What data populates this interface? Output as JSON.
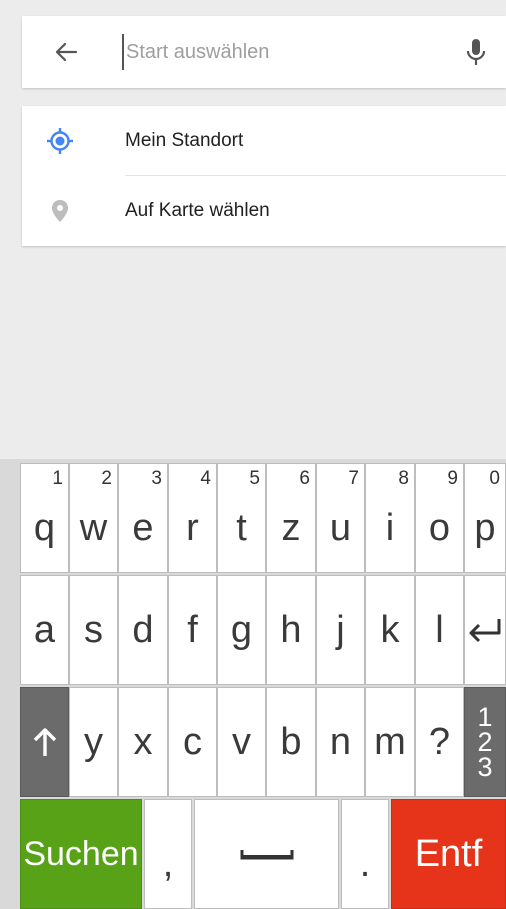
{
  "search": {
    "placeholder": "Start auswählen",
    "back_icon": "arrow-left-icon",
    "mic_icon": "microphone-icon"
  },
  "suggestions": [
    {
      "label": "Mein Standort",
      "icon": "my-location-icon",
      "icon_color": "#4285f4"
    },
    {
      "label": "Auf Karte wählen",
      "icon": "map-pin-icon",
      "icon_color": "#bdbdbd"
    }
  ],
  "keyboard": {
    "row1": [
      {
        "num": "1",
        "letter": "q"
      },
      {
        "num": "2",
        "letter": "w"
      },
      {
        "num": "3",
        "letter": "e"
      },
      {
        "num": "4",
        "letter": "r"
      },
      {
        "num": "5",
        "letter": "t"
      },
      {
        "num": "6",
        "letter": "z"
      },
      {
        "num": "7",
        "letter": "u"
      },
      {
        "num": "8",
        "letter": "i"
      },
      {
        "num": "9",
        "letter": "o"
      },
      {
        "num": "0",
        "letter": "p"
      }
    ],
    "row2": [
      "a",
      "s",
      "d",
      "f",
      "g",
      "h",
      "j",
      "k",
      "l"
    ],
    "enter_icon": "enter-icon",
    "shift_icon": "shift-up-arrow-icon",
    "row3": [
      "y",
      "x",
      "c",
      "v",
      "b",
      "n",
      "m",
      "?"
    ],
    "numbers_toggle": [
      "1",
      "2",
      "3"
    ],
    "search_label": "Suchen",
    "comma": ",",
    "space_icon": "space-bar-icon",
    "period": ".",
    "delete_label": "Entf",
    "colors": {
      "search": "#57a217",
      "delete": "#e53419",
      "modifier": "#6b6b6b"
    }
  }
}
